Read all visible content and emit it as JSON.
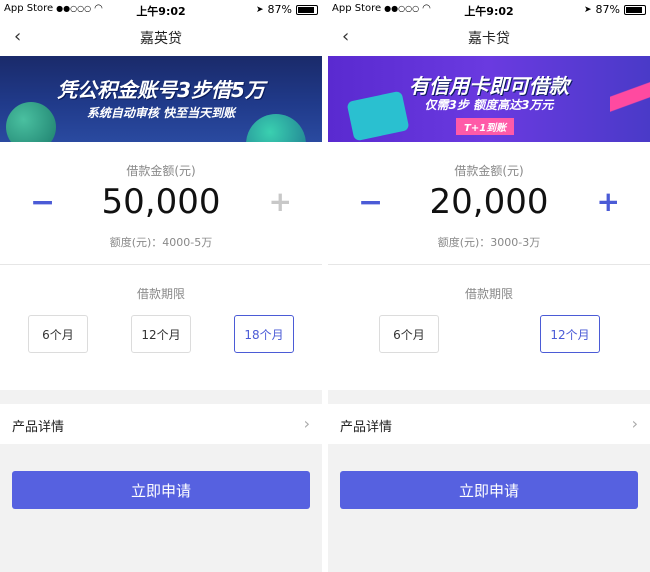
{
  "status_bar": {
    "back_app": "App Store",
    "signal": "●●○○○",
    "time": "上午9:02",
    "battery": "87%"
  },
  "panels": [
    {
      "nav_title": "嘉英贷",
      "banner_title": "凭公积金账号3步借5万",
      "banner_sub": "系统自动审核 快至当天到账",
      "amount_label": "借款金额(元)",
      "amount_value": "50,000",
      "amount_range": "额度(元)：4000-5万",
      "term_label": "借款期限",
      "terms": [
        "6个月",
        "12个月",
        "18个月"
      ],
      "selected_term": "18个月",
      "detail_label": "产品详情",
      "apply_label": "立即申请",
      "plus_color": "#c8c8c8"
    },
    {
      "nav_title": "嘉卡贷",
      "banner_title": "有信用卡即可借款",
      "banner_sub": "仅需3步 额度高达3万元",
      "banner_tag": "T+1到账",
      "amount_label": "借款金额(元)",
      "amount_value": "20,000",
      "amount_range": "额度(元)：3000-3万",
      "term_label": "借款期限",
      "terms": [
        "6个月",
        "12个月"
      ],
      "selected_term": "12个月",
      "detail_label": "产品详情",
      "apply_label": "立即申请",
      "plus_color": "#4b5bd6"
    }
  ],
  "colors": {
    "accent": "#4b5bd6",
    "button": "#5661e0"
  },
  "icons": {
    "back": "chevron-left-icon",
    "detail": "chevron-right-icon",
    "minus": "minus-icon",
    "plus": "plus-icon"
  }
}
